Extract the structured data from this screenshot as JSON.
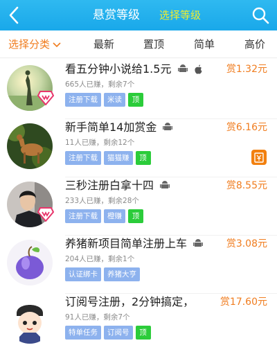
{
  "header": {
    "title": "悬赏等级",
    "subtitle": "选择等级",
    "back_icon": "chevron-left-icon",
    "search_icon": "search-icon"
  },
  "filter": {
    "category": "选择分类",
    "sorts": [
      "最新",
      "置顶",
      "简单",
      "高价"
    ]
  },
  "colors": {
    "brand": "#19a8ea",
    "accent": "#f07c1e",
    "tag_blue": "#8db2ee",
    "tag_green": "#2bcc3a"
  },
  "tasks": [
    {
      "title": "看五分钟小说给1.5元",
      "reward": "赏1.32元",
      "meta": "665人已赚，剩余7个",
      "tags": [
        "注册下载",
        "米读"
      ],
      "top_label": "顶",
      "platforms": [
        "android",
        "apple"
      ]
    },
    {
      "title": "新手简单14加赏金",
      "reward": "赏6.16元",
      "meta": "11人已赚，剩余12个",
      "tags": [
        "注册下载",
        "猫猫赚"
      ],
      "top_label": "顶",
      "platforms": [
        "android"
      ]
    },
    {
      "title": "三秒注册白拿十四",
      "reward": "赏8.55元",
      "meta": "233人已赚，剩余28个",
      "tags": [
        "注册下载",
        "橙赚"
      ],
      "top_label": "顶",
      "platforms": [
        "android"
      ]
    },
    {
      "title": "养猪新项目简单注册上车",
      "reward": "赏3.08元",
      "meta": "204人已赚，剩余1个",
      "tags": [
        "认证绑卡",
        "养猪大亨"
      ],
      "top_label": "",
      "platforms": [
        "android"
      ]
    },
    {
      "title": "订阅号注册，2分钟搞定，",
      "reward": "赏17.60元",
      "meta": "91人已赚，剩余7个",
      "tags": [
        "特单任务",
        "订阅号"
      ],
      "top_label": "顶",
      "platforms": []
    }
  ]
}
